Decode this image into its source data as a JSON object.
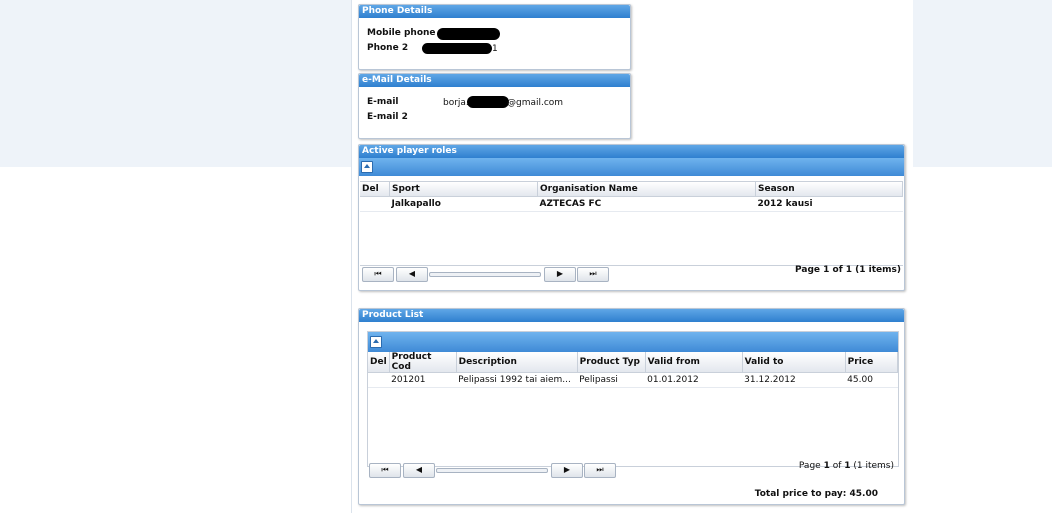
{
  "phone_panel": {
    "title": "Phone Details",
    "mobile_label": "Mobile phone",
    "phone2_label": "Phone 2",
    "phone2_suffix": "1"
  },
  "email_panel": {
    "title": "e-Mail Details",
    "email_label": "E-mail",
    "email2_label": "E-mail 2",
    "email_prefix": "borja.",
    "email_suffix": "@gmail.com"
  },
  "roles_panel": {
    "title": "Active player roles",
    "columns": [
      "Del",
      "Sport",
      "Organisation Name",
      "Season"
    ],
    "rows": [
      {
        "del": "",
        "sport": "Jalkapallo",
        "org": "AZTECAS FC",
        "season": "2012 kausi"
      }
    ],
    "pager": {
      "first": "⏮",
      "prev": "◀",
      "next": "▶",
      "last": "⏭",
      "status": "Page 1 of 1 (1 items)"
    }
  },
  "product_panel": {
    "title": "Product List",
    "columns": [
      "Del",
      "Product Cod",
      "Description",
      "Product Typ",
      "Valid from",
      "Valid to",
      "Price"
    ],
    "rows": [
      {
        "del": "",
        "code": "201201",
        "desc": "Pelipassi 1992 tai aiem...",
        "type": "Pelipassi",
        "from": "01.01.2012",
        "to": "31.12.2012",
        "price": "45.00"
      }
    ],
    "pager": {
      "status_pre": "Page ",
      "page": "1",
      "status_mid": " of ",
      "total": "1",
      "status_post": " (1 items)"
    },
    "total_label": "Total price to pay:",
    "total_value": "45.00"
  },
  "colors": {
    "header_blue": "#2f7fcf",
    "panel_border": "#b9c6d6"
  }
}
